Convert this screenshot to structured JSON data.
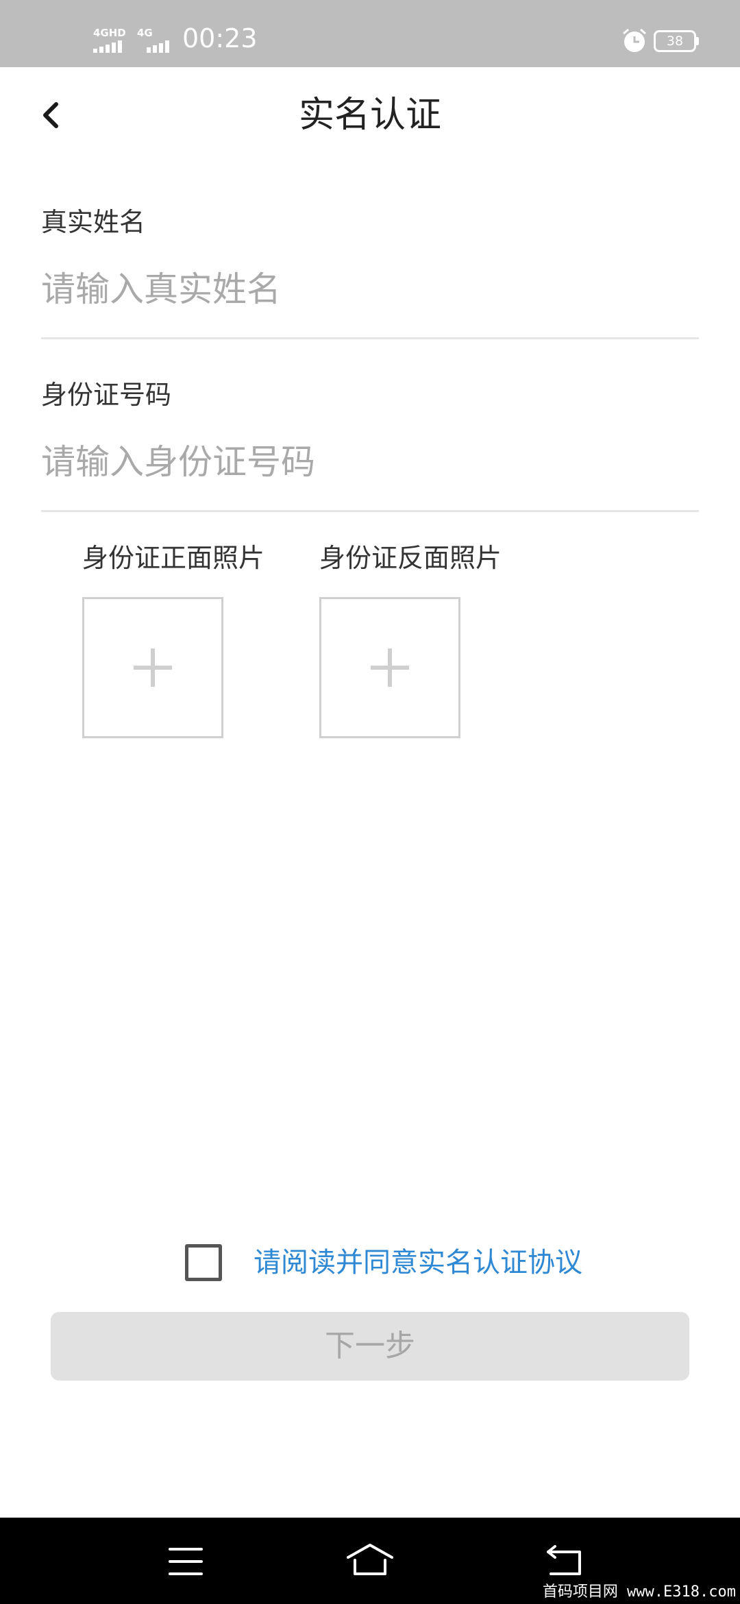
{
  "status_bar": {
    "sim1_label": "4GHD",
    "sim2_label": "4G",
    "time": "00:23",
    "battery_level": "38",
    "icons": [
      "signal-icon",
      "alarm-icon",
      "battery-icon"
    ]
  },
  "header": {
    "title": "实名认证",
    "back_icon": "chevron-left-icon"
  },
  "form": {
    "name_label": "真实姓名",
    "name_placeholder": "请输入真实姓名",
    "name_value": "",
    "id_label": "身份证号码",
    "id_placeholder": "请输入身份证号码",
    "id_value": ""
  },
  "photos": {
    "front_label": "身份证正面照片",
    "back_label": "身份证反面照片",
    "add_icon": "plus-icon"
  },
  "agreement": {
    "checked": false,
    "text": "请阅读并同意实名认证协议",
    "link_color": "#2e88d3"
  },
  "next_button": {
    "label": "下一步",
    "disabled": true
  },
  "nav_bar": {
    "icons": [
      "menu-icon",
      "home-icon",
      "back-icon"
    ]
  },
  "watermark": "首码项目网 www.E318.com"
}
